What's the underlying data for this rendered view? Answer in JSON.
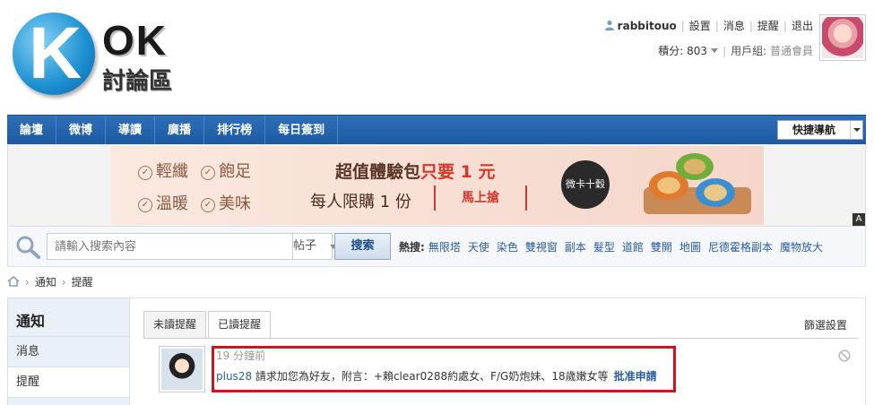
{
  "site": {
    "logo_letter": "K",
    "logo_ok": "OK",
    "logo_sub": "討論區"
  },
  "userbar": {
    "username": "rabbitouo",
    "links": [
      "設置",
      "消息",
      "提醒",
      "退出"
    ],
    "points_label": "積分: 803",
    "group_label": "用戶組:",
    "group_value": "普通會員"
  },
  "nav": {
    "items": [
      "論壇",
      "微博",
      "導讀",
      "廣播",
      "排行榜",
      "每日簽到"
    ],
    "quicknav_label": "快捷導航"
  },
  "ad": {
    "features": [
      "輕纖",
      "飽足",
      "溫暖",
      "美味"
    ],
    "headline_a": "超值體驗包",
    "headline_b": "只要",
    "headline_c": "1 元",
    "line2": "每人限購 1 份",
    "cta": "馬上搶",
    "brand": "微卡十穀粥",
    "mark": "A"
  },
  "search": {
    "placeholder": "請輸入搜索內容",
    "type": "帖子",
    "button": "搜索",
    "hot_label": "熱搜:",
    "hot_terms": [
      "無限塔",
      "天使",
      "染色",
      "雙視窗",
      "副本",
      "髮型",
      "道館",
      "雙開",
      "地圖",
      "尼德霍格副本",
      "魔物放大"
    ]
  },
  "breadcrumb": [
    "通知",
    "提醒"
  ],
  "sidebar": {
    "title": "通知",
    "items": [
      {
        "label": "消息",
        "active": false
      },
      {
        "label": "提醒",
        "active": true
      }
    ]
  },
  "main": {
    "tabs": [
      {
        "label": "未讀提醒",
        "active": false
      },
      {
        "label": "已讀提醒",
        "active": true
      }
    ],
    "filter": "篩選設置",
    "notification": {
      "time": "19 分鐘前",
      "user": "plus28",
      "message": "請求加您為好友，附言：+賴clear0288約處女、F/G奶炮妹、18歲嫩女等",
      "action": "批准申請"
    }
  },
  "colors": {
    "nav": "#1c5aa3",
    "link": "#2a5d9f",
    "highlight": "#d0141c",
    "sidebar": "#e9f0f7"
  }
}
